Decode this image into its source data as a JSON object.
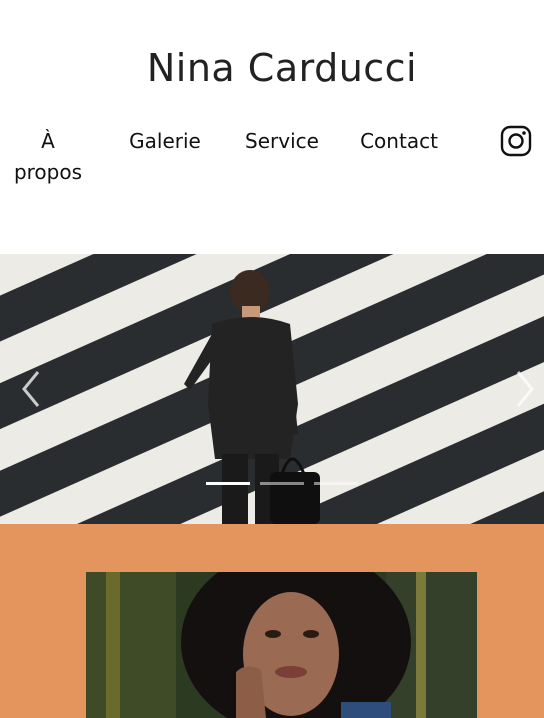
{
  "site": {
    "title": "Nina Carducci"
  },
  "nav": {
    "items": [
      {
        "label": "À propos"
      },
      {
        "label": "Galerie"
      },
      {
        "label": "Service"
      },
      {
        "label": "Contact"
      }
    ],
    "social_icon": "instagram-icon"
  },
  "carousel": {
    "slide_count": 3,
    "active_index": 0,
    "prev_icon": "chevron-left-icon",
    "next_icon": "chevron-right-icon"
  },
  "about": {
    "background_color": "#e4945d"
  }
}
